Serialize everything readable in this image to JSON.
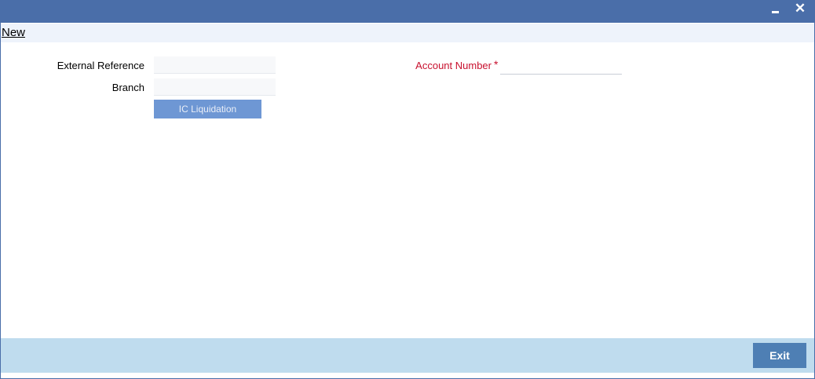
{
  "window": {
    "title": "",
    "minimize_icon": "minimize-icon",
    "close_icon": "close-icon",
    "close_glyph": "✕"
  },
  "menu": {
    "new_label": "New"
  },
  "form": {
    "external_reference": {
      "label": "External Reference",
      "value": ""
    },
    "branch": {
      "label": "Branch",
      "value": ""
    },
    "ic_liquidation_label": "IC Liquidation",
    "account_number": {
      "label": "Account Number",
      "required_mark": "*",
      "value": ""
    }
  },
  "footer": {
    "exit_label": "Exit"
  },
  "colors": {
    "title_bar": "#4a6ea9",
    "menu_bar": "#eef3fb",
    "footer_bar": "#bfdcee",
    "required_label": "#c8102e",
    "primary_button": "#6e97d4",
    "exit_button": "#4e7fb4"
  }
}
